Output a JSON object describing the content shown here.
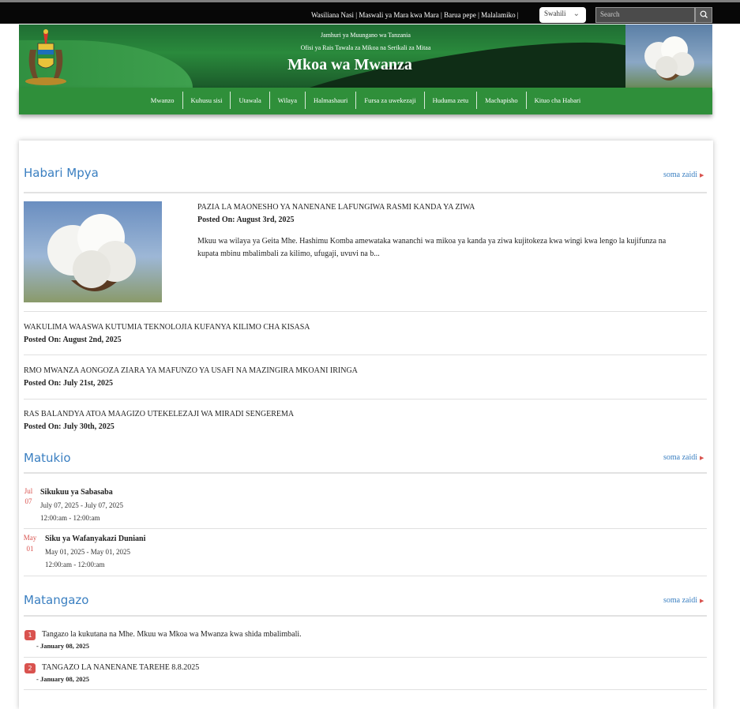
{
  "topbar": {
    "links": [
      "Wasiliana Nasi",
      "Maswali ya Mara kwa Mara",
      "Barua pepe",
      "Malalamiko"
    ],
    "language": "Swahili",
    "search_placeholder": "Search"
  },
  "banner": {
    "line1": "Jamhuri ya Muungano wa Tanzania",
    "line2": "Ofisi ya Rais Tawala za Mikoa na Serikali za Mitaa",
    "title": "Mkoa wa Mwanza"
  },
  "nav": [
    "Mwanzo",
    "Kuhusu sisi",
    "Utawala",
    "Wilaya",
    "Halmashauri",
    "Fursa za uwekezaji",
    "Huduma zetu",
    "Machapisho",
    "Kituo cha Habari"
  ],
  "news": {
    "title": "Habari Mpya",
    "more": "soma zaidi",
    "featured": {
      "headline": "PAZIA LA MAONESHO YA NANENANE LAFUNGIWA RASMI KANDA YA ZIWA",
      "posted": "Posted On: August 3rd, 2025",
      "summary_line1": "Mkuu wa wilaya ya Geita Mhe. Hashimu Komba amewataka wananchi wa mikoa ya kanda ya ziwa kujitokeza kwa wingi kwa lengo la kujifunza na",
      "summary_line2": "kupata mbinu mbalimbali za kilimo, ufugaji, uvuvi na b..."
    },
    "items": [
      {
        "headline": "WAKULIMA WAASWA KUTUMIA TEKNOLOJIA KUFANYA KILIMO CHA KISASA",
        "posted": "Posted On: August 2nd, 2025"
      },
      {
        "headline": "RMO MWANZA AONGOZA ZIARA YA MAFUNZO YA USAFI NA MAZINGIRA MKOANI IRINGA",
        "posted": "Posted On: July 21st, 2025"
      },
      {
        "headline": "RAS BALANDYA ATOA MAAGIZO UTEKELEZAJI WA MIRADI SENGEREMA",
        "posted": "Posted On: July 30th, 2025"
      }
    ]
  },
  "events": {
    "title": "Matukio",
    "more": "soma zaidi",
    "items": [
      {
        "month": "Jul",
        "day": "07",
        "name": "Sikukuu ya Sabasaba",
        "dates": "July 07, 2025 - July 07, 2025",
        "time": "12:00:am - 12:00:am"
      },
      {
        "month": "May",
        "day": "01",
        "name": "Siku ya Wafanyakazi Duniani",
        "dates": "May 01, 2025 - May 01, 2025",
        "time": "12:00:am - 12:00:am"
      }
    ]
  },
  "notices": {
    "title": "Matangazo",
    "more": "soma zaidi",
    "items": [
      {
        "num": "1",
        "text": "Tangazo la kukutana na Mhe. Mkuu wa Mkoa wa Mwanza kwa shida mbalimbali.",
        "date": "- January 08, 2025"
      },
      {
        "num": "2",
        "text": "TANGAZO LA NANENANE TAREHE 8.8.2025",
        "date": "- January 08, 2025"
      }
    ]
  }
}
